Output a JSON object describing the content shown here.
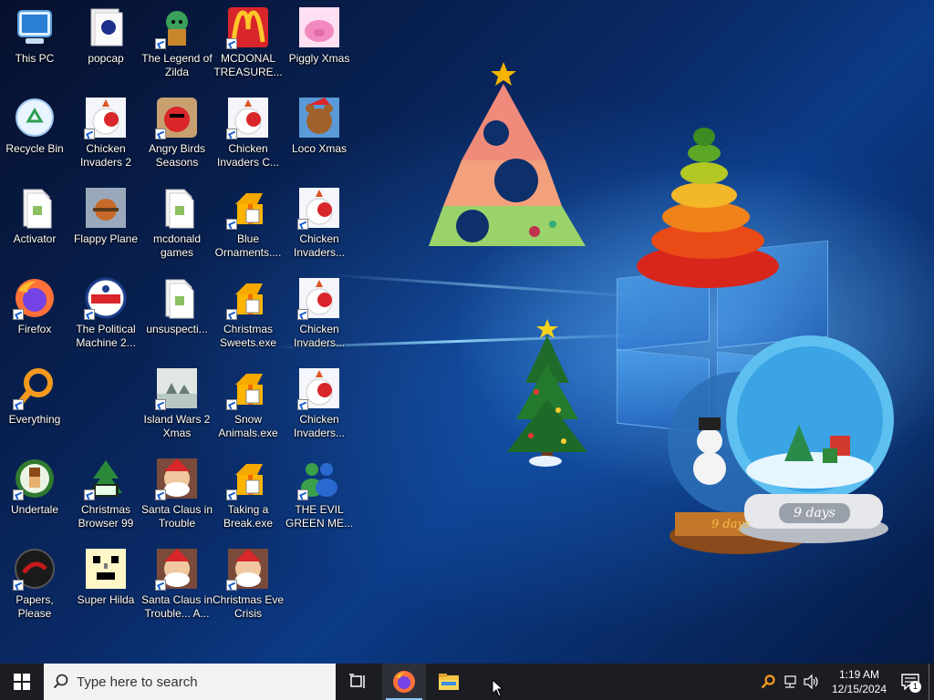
{
  "desktop_icons": [
    {
      "label": "This PC",
      "col": 0,
      "row": 0,
      "shortcut": false,
      "icon": "computer-icon"
    },
    {
      "label": "popcap",
      "col": 1,
      "row": 0,
      "shortcut": false,
      "icon": "folder-icon"
    },
    {
      "label": "The Legend of Zilda",
      "col": 2,
      "row": 0,
      "shortcut": true,
      "icon": "game-icon"
    },
    {
      "label": "MCDONAL TREASURE...",
      "col": 3,
      "row": 0,
      "shortcut": true,
      "icon": "mcdonalds-icon"
    },
    {
      "label": "Piggly Xmas",
      "col": 4,
      "row": 0,
      "shortcut": false,
      "icon": "pig-icon"
    },
    {
      "label": "Recycle Bin",
      "col": 0,
      "row": 1,
      "shortcut": false,
      "icon": "recycle-bin-icon"
    },
    {
      "label": "Chicken Invaders 2",
      "col": 1,
      "row": 1,
      "shortcut": true,
      "icon": "chicken-icon"
    },
    {
      "label": "Angry Birds Seasons",
      "col": 2,
      "row": 1,
      "shortcut": true,
      "icon": "angry-bird-icon"
    },
    {
      "label": "Chicken Invaders C...",
      "col": 3,
      "row": 1,
      "shortcut": true,
      "icon": "chicken-icon"
    },
    {
      "label": "Loco Xmas",
      "col": 4,
      "row": 1,
      "shortcut": false,
      "icon": "bear-icon"
    },
    {
      "label": "Activator",
      "col": 0,
      "row": 2,
      "shortcut": false,
      "icon": "file-icon"
    },
    {
      "label": "Flappy Plane",
      "col": 1,
      "row": 2,
      "shortcut": false,
      "icon": "plane-icon"
    },
    {
      "label": "mcdonald games",
      "col": 2,
      "row": 2,
      "shortcut": false,
      "icon": "file-icon"
    },
    {
      "label": "Blue Ornaments....",
      "col": 3,
      "row": 2,
      "shortcut": true,
      "icon": "gift-icon"
    },
    {
      "label": "Chicken Invaders...",
      "col": 4,
      "row": 2,
      "shortcut": true,
      "icon": "chicken-icon"
    },
    {
      "label": "Firefox",
      "col": 0,
      "row": 3,
      "shortcut": true,
      "icon": "firefox-icon"
    },
    {
      "label": "The Political Machine 2...",
      "col": 1,
      "row": 3,
      "shortcut": true,
      "icon": "political-icon"
    },
    {
      "label": "unsuspecti...",
      "col": 2,
      "row": 3,
      "shortcut": false,
      "icon": "file-icon"
    },
    {
      "label": "Christmas Sweets.exe",
      "col": 3,
      "row": 3,
      "shortcut": true,
      "icon": "gift-icon"
    },
    {
      "label": "Chicken Invaders...",
      "col": 4,
      "row": 3,
      "shortcut": true,
      "icon": "chicken-icon"
    },
    {
      "label": "Everything",
      "col": 0,
      "row": 4,
      "shortcut": true,
      "icon": "search-ring-icon"
    },
    {
      "label": "Island Wars 2 Xmas",
      "col": 2,
      "row": 4,
      "shortcut": true,
      "icon": "island-icon"
    },
    {
      "label": "Snow Animals.exe",
      "col": 3,
      "row": 4,
      "shortcut": true,
      "icon": "gift-icon"
    },
    {
      "label": "Chicken Invaders...",
      "col": 4,
      "row": 4,
      "shortcut": true,
      "icon": "chicken-icon"
    },
    {
      "label": "Undertale",
      "col": 0,
      "row": 5,
      "shortcut": true,
      "icon": "undertale-icon"
    },
    {
      "label": "Christmas Browser 99",
      "col": 1,
      "row": 5,
      "shortcut": true,
      "icon": "xmas-tree-icon"
    },
    {
      "label": "Santa Claus in Trouble",
      "col": 2,
      "row": 5,
      "shortcut": true,
      "icon": "santa-icon"
    },
    {
      "label": "Taking a Break.exe",
      "col": 3,
      "row": 5,
      "shortcut": true,
      "icon": "gift-icon"
    },
    {
      "label": "THE EVIL GREEN ME...",
      "col": 4,
      "row": 5,
      "shortcut": true,
      "icon": "messenger-icon"
    },
    {
      "label": "Papers, Please",
      "col": 0,
      "row": 6,
      "shortcut": true,
      "icon": "papers-icon"
    },
    {
      "label": "Super Hilda",
      "col": 1,
      "row": 6,
      "shortcut": false,
      "icon": "pixel-icon"
    },
    {
      "label": "Santa Claus in Trouble... A...",
      "col": 2,
      "row": 6,
      "shortcut": true,
      "icon": "santa-icon"
    },
    {
      "label": "Christmas Eve Crisis",
      "col": 3,
      "row": 6,
      "shortcut": true,
      "icon": "santa-icon"
    }
  ],
  "widgets": {
    "snow_globe_text": "9 days",
    "snow_globe_base_text": "9 days"
  },
  "taskbar": {
    "search_placeholder": "Type here to search",
    "pinned": [
      {
        "name": "task-view",
        "icon": "task-view-icon",
        "active": false
      },
      {
        "name": "firefox",
        "icon": "firefox-icon",
        "active": true
      },
      {
        "name": "file-explorer",
        "icon": "folder-icon",
        "active": false
      }
    ],
    "clock_time": "1:19 AM",
    "clock_date": "12/15/2024",
    "notification_count": "1"
  }
}
